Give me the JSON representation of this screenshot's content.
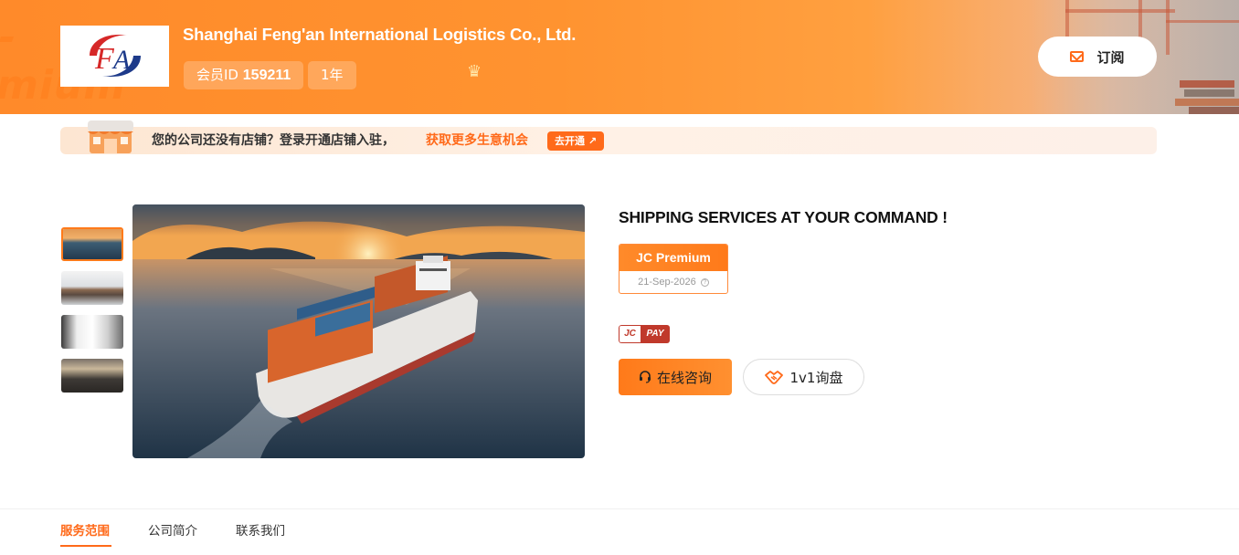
{
  "header": {
    "company_name": "Shanghai Feng'an International Logistics Co., Ltd.",
    "member_id_label": "会员ID",
    "member_id": "159211",
    "years": "1年",
    "subscribe_label": "订阅",
    "watermark": "mium"
  },
  "notice": {
    "text": "您的公司还没有店铺？登录开通店铺入驻，",
    "highlight": "获取更多生意机会",
    "button": "去开通 ↗"
  },
  "info": {
    "slogan": "SHIPPING SERVICES AT YOUR COMMAND !",
    "badge_title": "JC Premium",
    "badge_date": "21-Sep-2026",
    "jcpay_left": "JC",
    "jcpay_right": "PAY",
    "consult_button": "在线咨询",
    "inquiry_button": "1v1询盘"
  },
  "tabs": [
    {
      "label": "服务范围"
    },
    {
      "label": "公司简介"
    },
    {
      "label": "联系我们"
    }
  ],
  "colors": {
    "brand_orange": "#ff7a1a",
    "accent": "#ff6a1a"
  }
}
